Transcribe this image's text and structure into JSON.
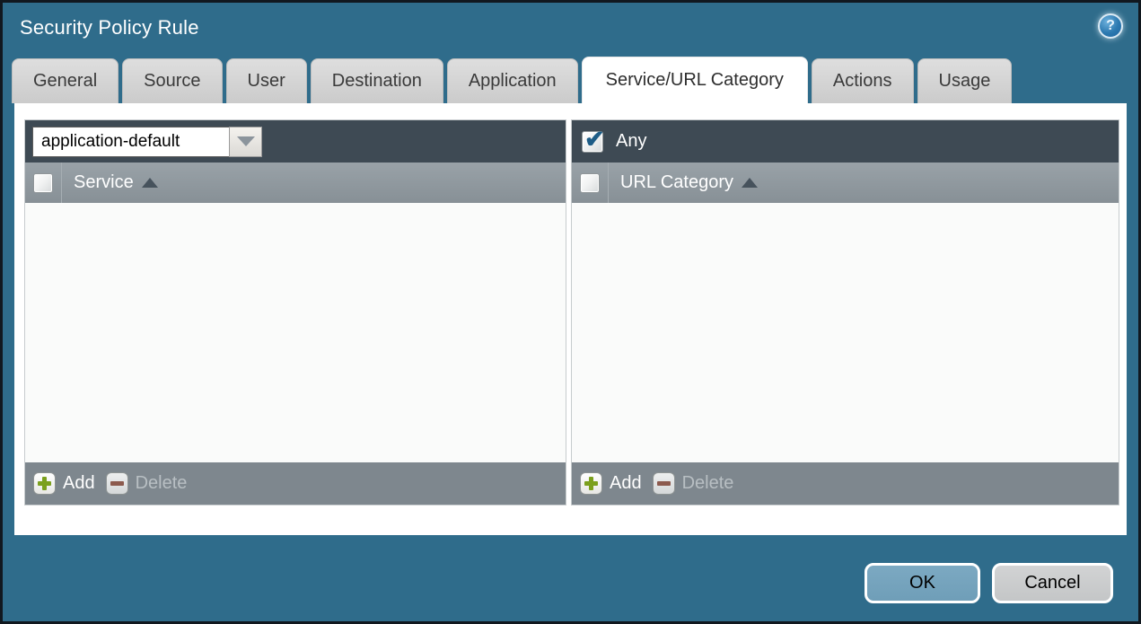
{
  "dialog": {
    "title": "Security Policy Rule"
  },
  "tabs": [
    {
      "label": "General",
      "active": false
    },
    {
      "label": "Source",
      "active": false
    },
    {
      "label": "User",
      "active": false
    },
    {
      "label": "Destination",
      "active": false
    },
    {
      "label": "Application",
      "active": false
    },
    {
      "label": "Service/URL Category",
      "active": true
    },
    {
      "label": "Actions",
      "active": false
    },
    {
      "label": "Usage",
      "active": false
    }
  ],
  "active_tab": "Service/URL Category",
  "service_panel": {
    "dropdown_value": "application-default",
    "column_header": "Service",
    "sort_order": "ascending",
    "select_all_checked": false,
    "rows": [],
    "add_label": "Add",
    "delete_label": "Delete",
    "delete_enabled": false
  },
  "url_category_panel": {
    "any_label": "Any",
    "any_checked": true,
    "column_header": "URL Category",
    "sort_order": "ascending",
    "select_all_checked": false,
    "rows": [],
    "add_label": "Add",
    "delete_label": "Delete",
    "delete_enabled": false
  },
  "buttons": {
    "ok": "OK",
    "cancel": "Cancel"
  },
  "icons": {
    "help": "? in glowing blue circle",
    "dropdown": "gray triangle pointing down",
    "sort": "dark triangle pointing up",
    "add": "green plus in white rounded square",
    "delete": "brown minus in gray rounded square"
  },
  "colors": {
    "dialog_background": "#2f6c8b",
    "panel_top_bar": "#3e4a54",
    "column_header": "#8b949b",
    "panel_footer": "#7e878e",
    "panel_body": "#fafbfa",
    "tab_inactive": "#d2d2d2",
    "tab_active": "#ffffff",
    "ok_button": "#75a3bd",
    "cancel_button": "#cacccd",
    "add_plus": "#7ba01d",
    "delete_minus": "#8c5a4e",
    "check_mark": "#1d5c86"
  }
}
